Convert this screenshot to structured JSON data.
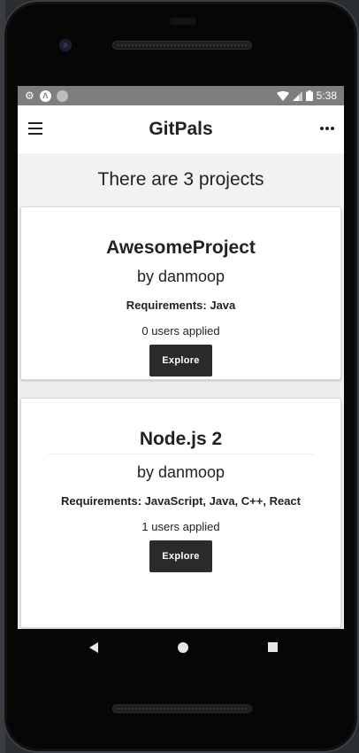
{
  "status_bar": {
    "time": "5:38",
    "left_icons": [
      "gear-icon",
      "a-circle-icon",
      "gray-dot-icon"
    ],
    "right_icons": [
      "wifi-icon",
      "signal-icon",
      "battery-icon"
    ]
  },
  "app_bar": {
    "title": "GitPals",
    "menu_icon": "hamburger-menu-icon",
    "more_icon": "more-horizontal-icon"
  },
  "banner": {
    "text": "There are 3 projects"
  },
  "projects": [
    {
      "name": "AwesomeProject",
      "author": "by danmoop",
      "requirements": "Requirements: Java",
      "applied": "0 users applied",
      "button": "Explore"
    },
    {
      "name": "Node.js 2",
      "author": "by danmoop",
      "requirements": "Requirements: JavaScript, Java, C++, React",
      "applied": "1 users applied",
      "button": "Explore"
    }
  ],
  "nav_bar": {
    "icons": [
      "back-icon",
      "home-icon",
      "recents-icon"
    ]
  },
  "colors": {
    "status_bar": "#7e7e7e",
    "button_bg": "#2b2b2b",
    "screen_bg": "#eeeeee"
  }
}
